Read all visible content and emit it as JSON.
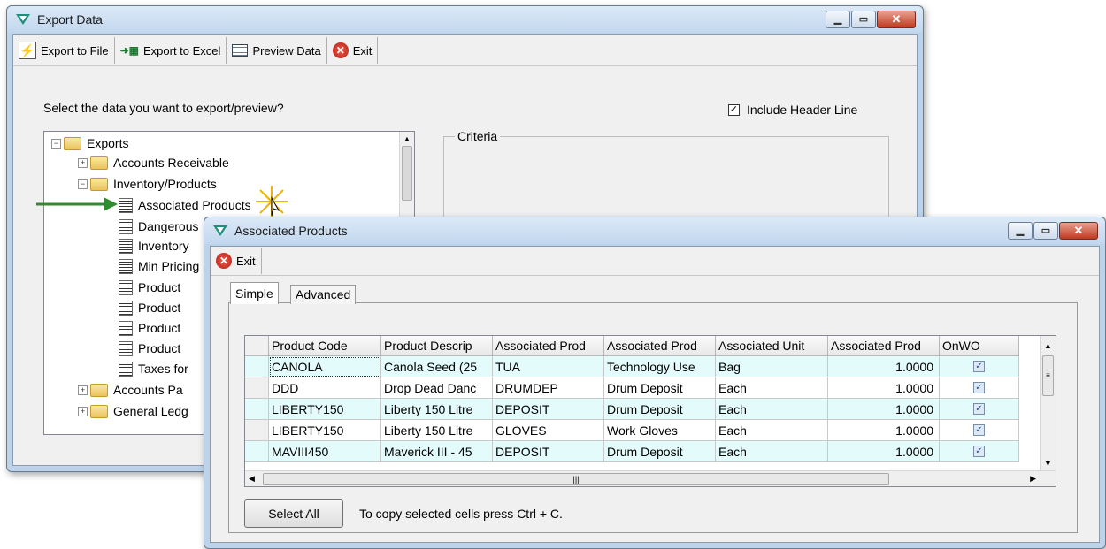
{
  "export_window": {
    "title": "Export Data",
    "toolbar": {
      "export_file": "Export to File",
      "export_excel": "Export to Excel",
      "preview": "Preview Data",
      "exit": "Exit"
    },
    "prompt": "Select the data you want to export/preview?",
    "include_header": "Include Header Line",
    "criteria_label": "Criteria",
    "tree": {
      "root": "Exports",
      "ar": "Accounts Receivable",
      "inv": "Inventory/Products",
      "items": [
        "Associated Products",
        "Dangerous",
        "Inventory",
        "Min Pricing",
        "Product",
        "Product",
        "Product",
        "Product",
        "Taxes for"
      ],
      "ap": "Accounts Pa",
      "gl": "General Ledg"
    }
  },
  "assoc_window": {
    "title": "Associated Products",
    "exit": "Exit",
    "tabs": [
      "Simple",
      "Advanced"
    ],
    "columns": [
      "Product Code",
      "Product Descrip",
      "Associated Prod",
      "Associated Prod",
      "Associated Unit",
      "Associated Prod",
      "OnWO"
    ],
    "rows": [
      [
        "CANOLA",
        "Canola Seed (25",
        "TUA",
        "Technology Use",
        "Bag",
        "1.0000",
        "✓"
      ],
      [
        "DDD",
        "Drop Dead Danc",
        "DRUMDEP",
        "Drum Deposit",
        "Each",
        "1.0000",
        "✓"
      ],
      [
        "LIBERTY150",
        "Liberty 150 Litre",
        "DEPOSIT",
        "Drum Deposit",
        "Each",
        "1.0000",
        "✓"
      ],
      [
        "LIBERTY150",
        "Liberty 150 Litre",
        "GLOVES",
        "Work Gloves",
        "Each",
        "1.0000",
        "✓"
      ],
      [
        "MAVIII450",
        "Maverick III - 45",
        "DEPOSIT",
        "Drum Deposit",
        "Each",
        "1.0000",
        "✓"
      ]
    ],
    "select_all": "Select All",
    "copy_hint": "To copy selected cells press Ctrl + C."
  },
  "colors": {
    "arrow": "#2e8b2e",
    "alt_row": "#e4fbfb"
  }
}
